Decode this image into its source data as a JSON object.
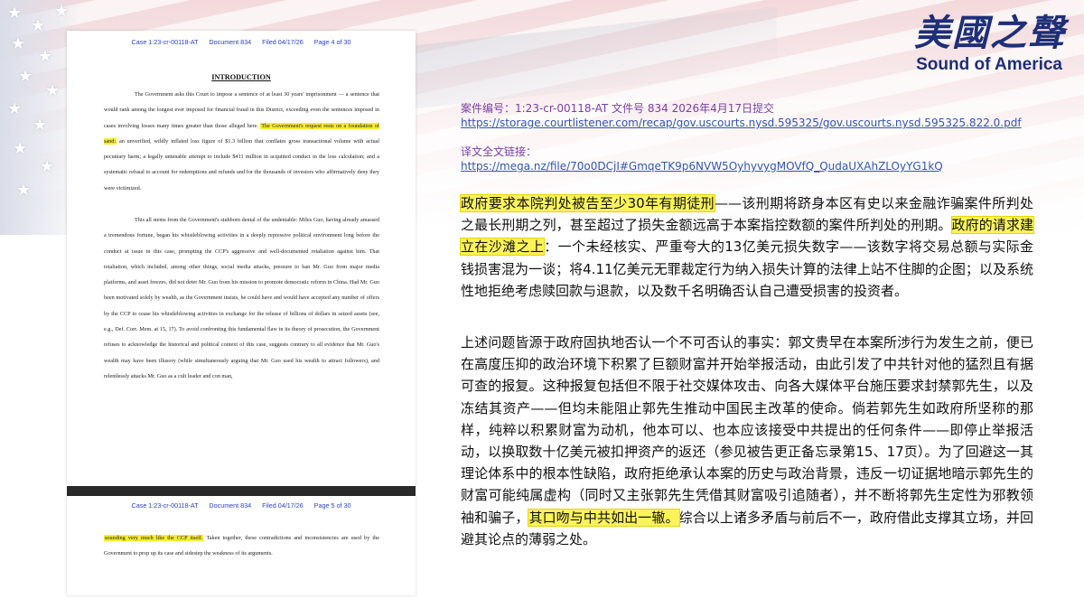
{
  "brand": {
    "logo_cn": "美國之聲",
    "logo_en": "Sound of America"
  },
  "document": {
    "page4_header": "Case 1:23-cr-00118-AT      Document 834      Filed 04/17/26      Page 4 of 30",
    "title": "INTRODUCTION",
    "p1_pre": "The Government asks this Court to impose a sentence of at least 30 years' imprisonment — a sentence that would rank among the longest ever imposed for financial fraud in this District, exceeding even the sentences imposed in cases involving losses many times greater than those alleged here. ",
    "p1_hl": "The Government's request rests on a foundation of sand:",
    "p1_post": " an unverified, wildly inflated loss figure of $1.3 billion that conflates gross transactional volume with actual pecuniary harm; a legally untenable attempt to include $411 million in acquitted conduct in the loss calculation; and a systematic refusal to account for redemptions and refunds and for the thousands of investors who affirmatively deny they were victimized.",
    "p2": "This all stems from the Government's stubborn denial of the undeniable: Miles Guo, having already amassed a tremendous fortune, began his whistleblowing activities in a deeply repressive political environment long before the conduct at issue in this case, prompting the CCP's aggressive and well-documented retaliation against him. That retaliation, which included, among other things, social media attacks, pressure to ban Mr. Guo from major media platforms, and asset freezes, did not deter Mr. Guo from his mission to promote democratic reform in China. Had Mr. Guo been motivated solely by wealth, as the Government insists, he could have and would have accepted any number of offers by the CCP to cease his whistleblowing activities in exchange for the release of billions of dollars in seized assets (see, e.g., Def. Corr. Mem. at 15, 17). To avoid confronting this fundamental flaw in its theory of prosecution, the Government refuses to acknowledge the historical and political context of this case, suggests contrary to all evidence that Mr. Guo's wealth may have been illusory (while simultaneously arguing that Mr. Guo used his wealth to attract followers), and relentlessly attacks Mr. Guo as a cult leader and con man,",
    "page5_header": "Case 1:23-cr-00118-AT      Document 834      Filed 04/17/26      Page 5 of 30",
    "p3_hl": "sounding very much like the CCP itself.",
    "p3_post": " Taken together, these contradictions and inconsistencies are used by the Government to prop up its case and sidestep the weakness of its arguments."
  },
  "meta": {
    "case_line": "案件编号：1:23-cr-00118-AT 文件号 834  2026年4月17日提交",
    "source_url": "https://storage.courtlistener.com/recap/gov.uscourts.nysd.595325/gov.uscourts.nysd.595325.822.0.pdf",
    "translation_label": "译文全文链接：",
    "translation_url": "https://mega.nz/file/70o0DCjI#GmqeTK9p6NVW5OyhyvygMOVfQ_QudaUXAhZLOyYG1kQ"
  },
  "translation": {
    "p1_hl1": "政府要求本院判处被告至少30年有期徒刑",
    "p1_mid": "——该刑期将跻身本区有史以来金融诈骗案件所判处之最长刑期之列，甚至超过了损失金额远高于本案指控数额的案件所判处的刑期。",
    "p1_hl2": "政府的请求建立在沙滩之上",
    "p1_post": "：一个未经核实、严重夸大的13亿美元损失数字——该数字将交易总额与实际金钱损害混为一谈；将4.11亿美元无罪裁定行为纳入损失计算的法律上站不住脚的企图；以及系统性地拒绝考虑赎回款与退款，以及数千名明确否认自己遭受损害的投资者。",
    "p2_pre": "上述问题皆源于政府固执地否认一个不可否认的事实：郭文贵早在本案所涉行为发生之前，便已在高度压抑的政治环境下积累了巨额财富并开始举报活动，由此引发了中共针对他的猛烈且有据可查的报复。这种报复包括但不限于社交媒体攻击、向各大媒体平台施压要求封禁郭先生，以及冻结其资产——但均未能阻止郭先生推动中国民主改革的使命。倘若郭先生如政府所坚称的那样，纯粹以积累财富为动机，他本可以、也本应该接受中共提出的任何条件——即停止举报活动，以换取数十亿美元被扣押资产的返还（参见被告更正备忘录第15、17页）。为了回避这一其理论体系中的根本性缺陷，政府拒绝承认本案的历史与政治背景，违反一切证据地暗示郭先生的财富可能纯属虚构（同时又主张郭先生凭借其财富吸引追随者），并不断将郭先生定性为邪教领袖和骗子，",
    "p2_hl": "其口吻与中共如出一辙。",
    "p2_post": "综合以上诸多矛盾与前后不一，政府借此支撑其立场，并回避其论点的薄弱之处。"
  }
}
